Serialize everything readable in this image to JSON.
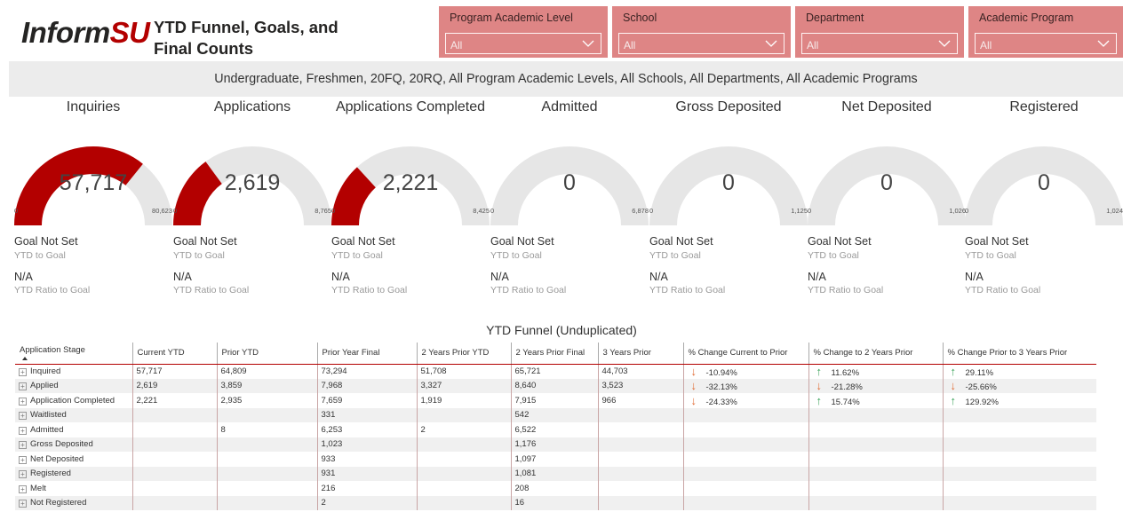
{
  "header": {
    "logo_main": "Inform",
    "logo_accent": "SU",
    "title_line1": "YTD Funnel, Goals, and",
    "title_line2": "Final Counts"
  },
  "filters": [
    {
      "label": "Program Academic Level",
      "value": "All"
    },
    {
      "label": "School",
      "value": "All"
    },
    {
      "label": "Department",
      "value": "All"
    },
    {
      "label": "Academic Program",
      "value": "All"
    }
  ],
  "context_text": "Undergraduate, Freshmen, 20FQ, 20RQ, All Program Academic Levels, All Schools, All Departments, All Academic Programs",
  "gauges": [
    {
      "title": "Inquiries",
      "value": "57,717",
      "min": "0",
      "max": "80,623",
      "fraction": 0.716,
      "goal": "Goal Not Set",
      "goal_label": "YTD to Goal",
      "ratio": "N/A",
      "ratio_label": "YTD Ratio to Goal"
    },
    {
      "title": "Applications",
      "value": "2,619",
      "min": "0",
      "max": "8,765",
      "fraction": 0.299,
      "goal": "Goal Not Set",
      "goal_label": "YTD to Goal",
      "ratio": "N/A",
      "ratio_label": "YTD Ratio to Goal"
    },
    {
      "title": "Applications Completed",
      "value": "2,221",
      "min": "0",
      "max": "8,425",
      "fraction": 0.264,
      "goal": "Goal Not Set",
      "goal_label": "YTD to Goal",
      "ratio": "N/A",
      "ratio_label": "YTD Ratio to Goal"
    },
    {
      "title": "Admitted",
      "value": "0",
      "min": "0",
      "max": "6,878",
      "fraction": 0,
      "goal": "Goal Not Set",
      "goal_label": "YTD to Goal",
      "ratio": "N/A",
      "ratio_label": "YTD Ratio to Goal"
    },
    {
      "title": "Gross Deposited",
      "value": "0",
      "min": "0",
      "max": "1,125",
      "fraction": 0,
      "goal": "Goal Not Set",
      "goal_label": "YTD to Goal",
      "ratio": "N/A",
      "ratio_label": "YTD Ratio to Goal"
    },
    {
      "title": "Net Deposited",
      "value": "0",
      "min": "0",
      "max": "1,026",
      "fraction": 0,
      "goal": "Goal Not Set",
      "goal_label": "YTD to Goal",
      "ratio": "N/A",
      "ratio_label": "YTD Ratio to Goal"
    },
    {
      "title": "Registered",
      "value": "0",
      "min": "0",
      "max": "1,024",
      "fraction": 0,
      "goal": "Goal Not Set",
      "goal_label": "YTD to Goal",
      "ratio": "N/A",
      "ratio_label": "YTD Ratio to Goal"
    }
  ],
  "table": {
    "title": "YTD Funnel (Unduplicated)",
    "headers": [
      "Application Stage",
      "Current YTD",
      "Prior YTD",
      "Prior Year Final",
      "2 Years Prior YTD",
      "2 Years Prior Final",
      "3 Years Prior",
      "% Change Current to Prior",
      "% Change to 2 Years Prior",
      "% Change Prior to 3 Years Prior"
    ],
    "rows": [
      {
        "stage": "Inquired",
        "cells": [
          "57,717",
          "64,809",
          "73,294",
          "51,708",
          "65,721",
          "44,703"
        ],
        "chg1": {
          "dir": "down",
          "val": "-10.94%"
        },
        "chg2": {
          "dir": "up",
          "val": "11.62%"
        },
        "chg3": {
          "dir": "up",
          "val": "29.11%"
        }
      },
      {
        "stage": "Applied",
        "cells": [
          "2,619",
          "3,859",
          "7,968",
          "3,327",
          "8,640",
          "3,523"
        ],
        "chg1": {
          "dir": "down",
          "val": "-32.13%"
        },
        "chg2": {
          "dir": "down",
          "val": "-21.28%"
        },
        "chg3": {
          "dir": "down",
          "val": "-25.66%"
        }
      },
      {
        "stage": "Application Completed",
        "cells": [
          "2,221",
          "2,935",
          "7,659",
          "1,919",
          "7,915",
          "966"
        ],
        "chg1": {
          "dir": "down",
          "val": "-24.33%"
        },
        "chg2": {
          "dir": "up",
          "val": "15.74%"
        },
        "chg3": {
          "dir": "up",
          "val": "129.92%"
        }
      },
      {
        "stage": "Waitlisted",
        "cells": [
          "",
          "",
          "331",
          "",
          "542",
          ""
        ],
        "chg1": null,
        "chg2": null,
        "chg3": null
      },
      {
        "stage": "Admitted",
        "cells": [
          "",
          "8",
          "6,253",
          "2",
          "6,522",
          ""
        ],
        "chg1": null,
        "chg2": null,
        "chg3": null
      },
      {
        "stage": "Gross Deposited",
        "cells": [
          "",
          "",
          "1,023",
          "",
          "1,176",
          ""
        ],
        "chg1": null,
        "chg2": null,
        "chg3": null
      },
      {
        "stage": "Net Deposited",
        "cells": [
          "",
          "",
          "933",
          "",
          "1,097",
          ""
        ],
        "chg1": null,
        "chg2": null,
        "chg3": null
      },
      {
        "stage": "Registered",
        "cells": [
          "",
          "",
          "931",
          "",
          "1,081",
          ""
        ],
        "chg1": null,
        "chg2": null,
        "chg3": null
      },
      {
        "stage": "Melt",
        "cells": [
          "",
          "",
          "216",
          "",
          "208",
          ""
        ],
        "chg1": null,
        "chg2": null,
        "chg3": null
      },
      {
        "stage": "Not Registered",
        "cells": [
          "",
          "",
          "2",
          "",
          "16",
          ""
        ],
        "chg1": null,
        "chg2": null,
        "chg3": null
      }
    ]
  },
  "colors": {
    "accent": "#b30000",
    "filter_bg": "#de8585",
    "gauge_track": "#e6e6e6",
    "arrow_down": "#e06b34",
    "arrow_up": "#3aa35a"
  }
}
